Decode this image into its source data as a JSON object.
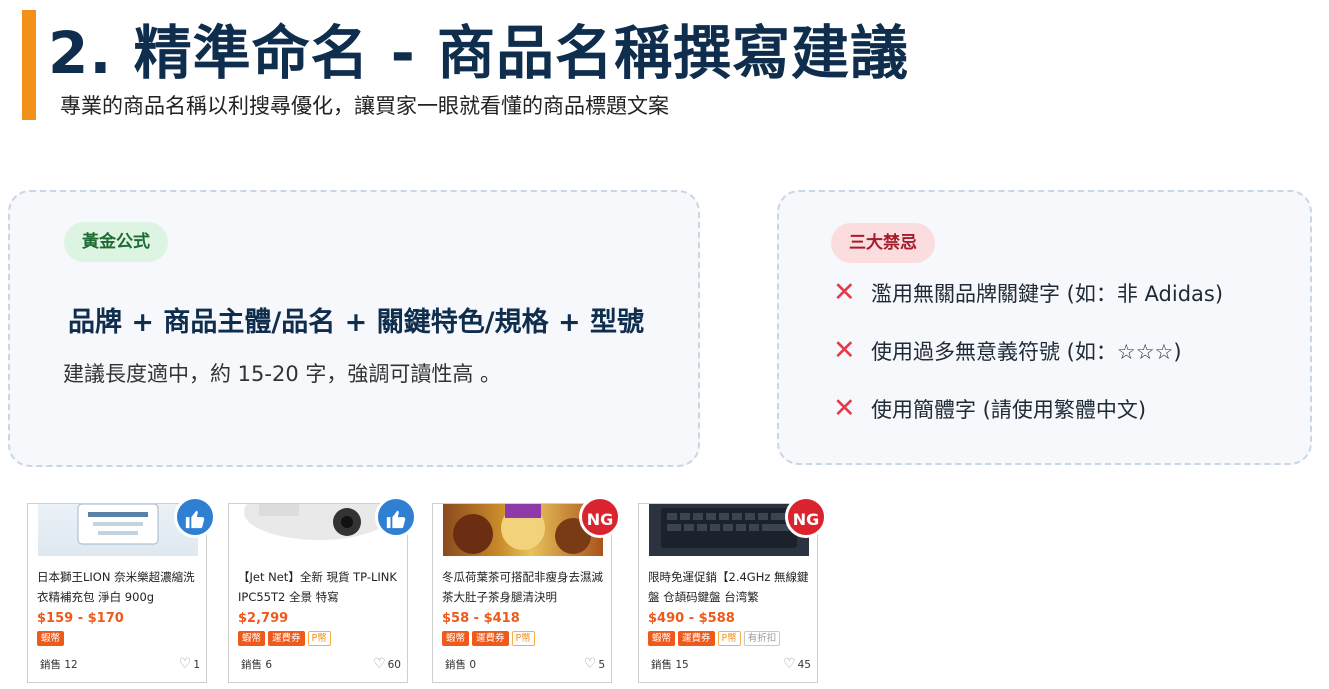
{
  "header": {
    "title": "2. 精準命名 - 商品名稱撰寫建議",
    "subtitle": "專業的商品名稱以利搜尋優化，讓買家一眼就看懂的商品標題文案"
  },
  "formula_card": {
    "badge": "黃金公式",
    "formula": "品牌 + 商品主體/品名 + 關鍵特色/規格 + 型號",
    "advice": "建議長度適中，約 15-20 字，強調可讀性高 。"
  },
  "taboo_card": {
    "badge": "三大禁忌",
    "items": [
      "濫用無關品牌關鍵字 (如：非 Adidas)",
      "使用過多無意義符號 (如：☆☆☆)",
      "使用簡體字 (請使用繁體中文)"
    ]
  },
  "products": [
    {
      "name": "日本獅王LION 奈米樂超濃縮洗衣精補充包 淨白 900g",
      "price": "$159 - $170",
      "tags": [
        "蝦幣"
      ],
      "sales": "銷售 12",
      "likes": "1",
      "badge": "thumbs-up"
    },
    {
      "name": "【Jet Net】全新 現貨 TP-LINK IPC55T2 全景 特寫",
      "price": "$2,799",
      "tags": [
        "蝦幣",
        "運費券",
        "P幣"
      ],
      "sales": "銷售 6",
      "likes": "60",
      "badge": "thumbs-up"
    },
    {
      "name": "冬瓜荷葉茶可搭配非瘦身去濕減茶大肚子茶身腿清決明",
      "price": "$58 - $418",
      "tags": [
        "蝦幣",
        "運費券",
        "P幣"
      ],
      "sales": "銷售 0",
      "likes": "5",
      "badge": "NG"
    },
    {
      "name": "限時免運促銷【2.4GHz 無線鍵盤 仓頡码鍵盤 台湾繁",
      "price": "$490 - $588",
      "tags": [
        "蝦幣",
        "運費券",
        "P幣",
        "有折扣"
      ],
      "sales": "銷售 15",
      "likes": "45",
      "badge": "NG"
    }
  ],
  "icons": {
    "like": "thumbs-up-icon",
    "ng": "ng-icon",
    "cross": "cross-icon",
    "heart": "heart-icon"
  },
  "colors": {
    "accent": "#f39019",
    "title": "#0f2d4d",
    "like": "#2f7fd3",
    "ng": "#d9232e",
    "price": "#ee5a1c"
  }
}
